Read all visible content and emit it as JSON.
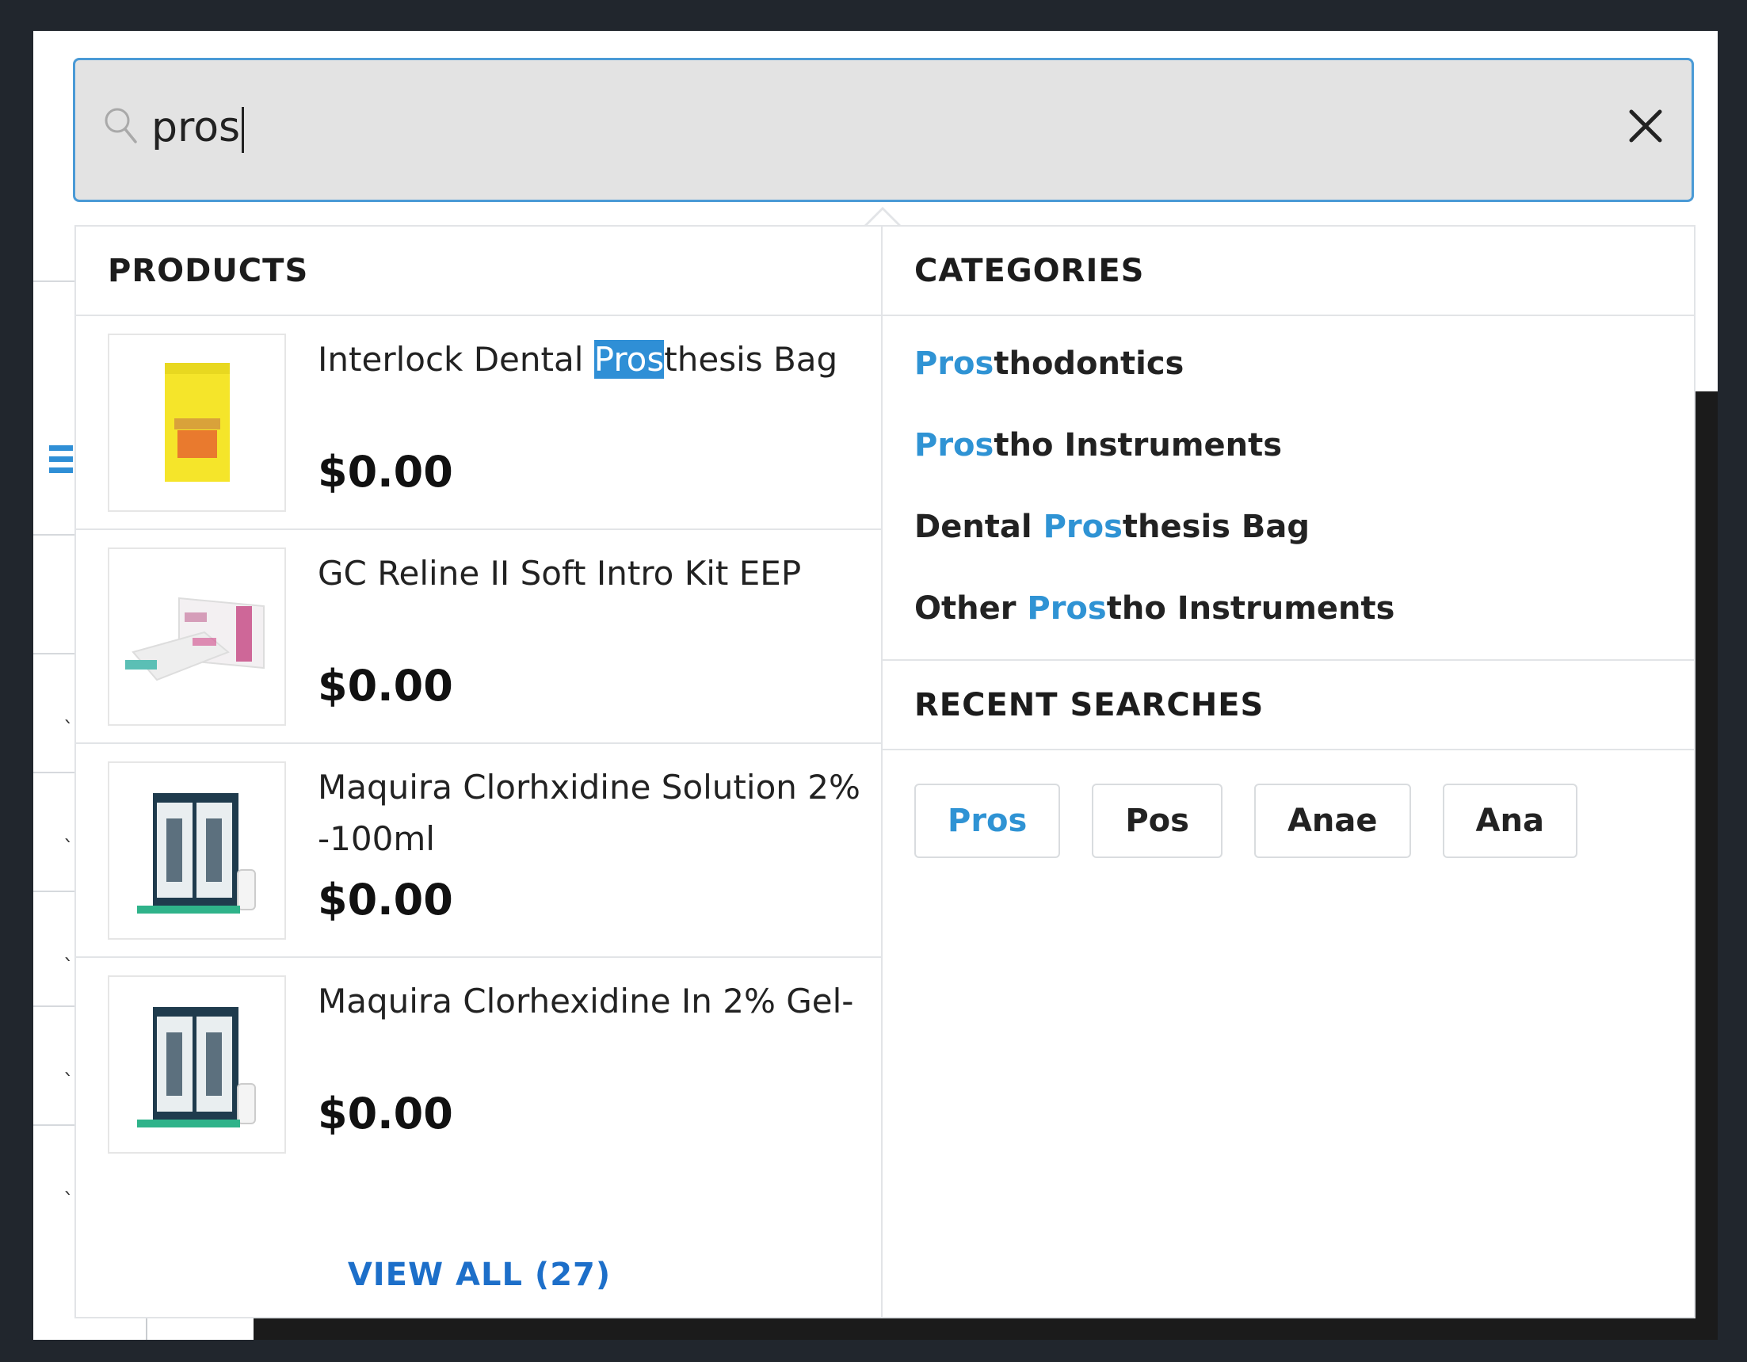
{
  "search": {
    "value": "pros"
  },
  "products": {
    "heading": "PRODUCTS",
    "items": [
      {
        "name_pre": "Interlock Dental ",
        "name_hl": "Pros",
        "name_post": "thesis Bag",
        "price": "$0.00"
      },
      {
        "name_pre": "GC Reline II Soft Intro Kit EEP",
        "name_hl": "",
        "name_post": "",
        "price": "$0.00"
      },
      {
        "name_pre": "Maquira Clorhxidine Solution 2% -100ml",
        "name_hl": "",
        "name_post": "",
        "price": "$0.00"
      },
      {
        "name_pre": "Maquira Clorhexidine In 2% Gel-",
        "name_hl": "",
        "name_post": "",
        "price": "$0.00"
      }
    ],
    "view_all": "VIEW ALL (27)"
  },
  "categories": {
    "heading": "CATEGORIES",
    "items": [
      {
        "pre": "",
        "hl": "Pros",
        "post": "thodontics"
      },
      {
        "pre": "",
        "hl": "Pros",
        "post": "tho Instruments"
      },
      {
        "pre": "Dental ",
        "hl": "Pros",
        "post": "thesis Bag"
      },
      {
        "pre": "Other ",
        "hl": "Pros",
        "post": "tho Instruments"
      }
    ]
  },
  "recent_searches": {
    "heading": "RECENT SEARCHES",
    "items": [
      "Pros",
      "Pos",
      "Anae",
      "Ana"
    ]
  },
  "colors": {
    "accent": "#2f93d4",
    "link": "#1d6fc9",
    "highlight_bg": "#2f8fd6",
    "frame": "#21262d"
  }
}
